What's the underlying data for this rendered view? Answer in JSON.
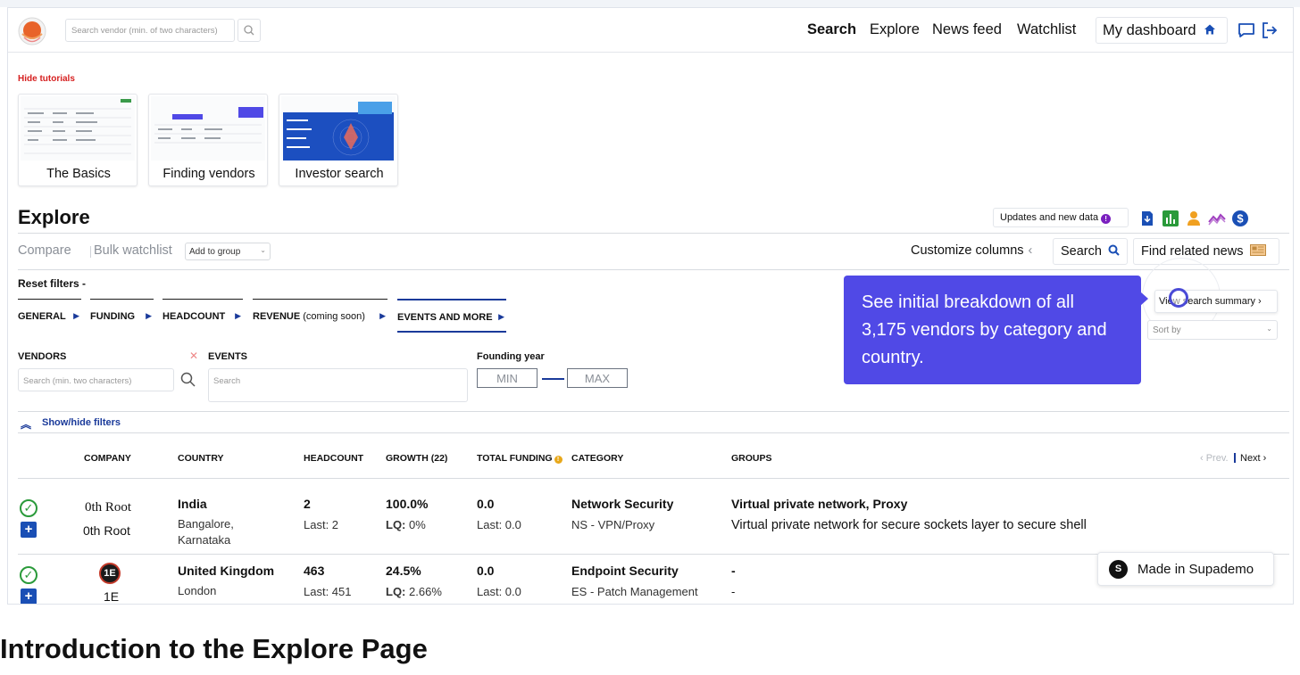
{
  "header": {
    "search_placeholder": "Search vendor (min. of two characters)",
    "nav": [
      "Search",
      "Explore",
      "News feed",
      "Watchlist"
    ],
    "dashboard_label": "My dashboard"
  },
  "tutorials": {
    "hide_label": "Hide tutorials",
    "cards": [
      "The Basics",
      "Finding vendors",
      "Investor search"
    ]
  },
  "explore": {
    "title": "Explore",
    "updates_label": "Updates and new data",
    "compare_label": "Compare",
    "bulk_watchlist_label": "Bulk watchlist",
    "add_to_group_label": "Add to group",
    "customize_columns_label": "Customize columns",
    "search_button_label": "Search",
    "find_news_label": "Find related news",
    "reset_filters_label": "Reset filters -",
    "tabs": [
      {
        "label": "GENERAL",
        "extra": ""
      },
      {
        "label": "FUNDING",
        "extra": ""
      },
      {
        "label": "HEADCOUNT",
        "extra": ""
      },
      {
        "label": "REVENUE",
        "extra": " (coming soon)"
      },
      {
        "label": "EVENTS AND MORE",
        "extra": ""
      }
    ],
    "filters": {
      "vendors_label": "VENDORS",
      "vendors_placeholder": "Search (min. two characters)",
      "events_label": "EVENTS",
      "events_placeholder": "Search",
      "founding_year_label": "Founding year",
      "min_label": "MIN",
      "max_label": "MAX"
    },
    "view_summary_label": "View search summary",
    "sort_by_label": "Sort by",
    "show_hide_label": "Show/hide filters"
  },
  "tooltip": {
    "text": "See initial breakdown of all 3,175 vendors by category and country."
  },
  "table": {
    "headers": {
      "company": "COMPANY",
      "country": "COUNTRY",
      "headcount": "HEADCOUNT",
      "growth": "GROWTH (22)",
      "total_funding": "TOTAL FUNDING",
      "category": "CATEGORY",
      "groups": "GROUPS"
    },
    "prev_label": "‹ Prev.",
    "next_label": "Next ›",
    "rows": [
      {
        "logo_text": "0th Root",
        "name": "0th Root",
        "country": "India",
        "location": "Bangalore, Karnataka",
        "headcount": "2",
        "headcount_last": "Last: 2",
        "growth": "100.0%",
        "lq_label": "LQ:",
        "lq_value": "0%",
        "funding": "0.0",
        "funding_last": "Last: 0.0",
        "category": "Network Security",
        "subcategory": "NS - VPN/Proxy",
        "group_title": "Virtual private network, Proxy",
        "group_desc": "Virtual private network for secure sockets layer to secure shell"
      },
      {
        "logo_text": "1E",
        "name": "1E",
        "country": "United Kingdom",
        "location": "London",
        "headcount": "463",
        "headcount_last": "Last: 451",
        "growth": "24.5%",
        "lq_label": "LQ:",
        "lq_value": "2.66%",
        "funding": "0.0",
        "funding_last": "Last: 0.0",
        "category": "Endpoint Security",
        "subcategory": "ES - Patch Management",
        "group_title": "-",
        "group_desc": "-"
      }
    ]
  },
  "supademo": {
    "logo": "S",
    "label": "Made in Supademo"
  },
  "page_heading": "Introduction to the Explore Page",
  "colors": {
    "accent_blue": "#1a3a9a",
    "tooltip_purple": "#5049e6",
    "tutorial_red": "#d62020",
    "check_green": "#2a9a3a"
  }
}
